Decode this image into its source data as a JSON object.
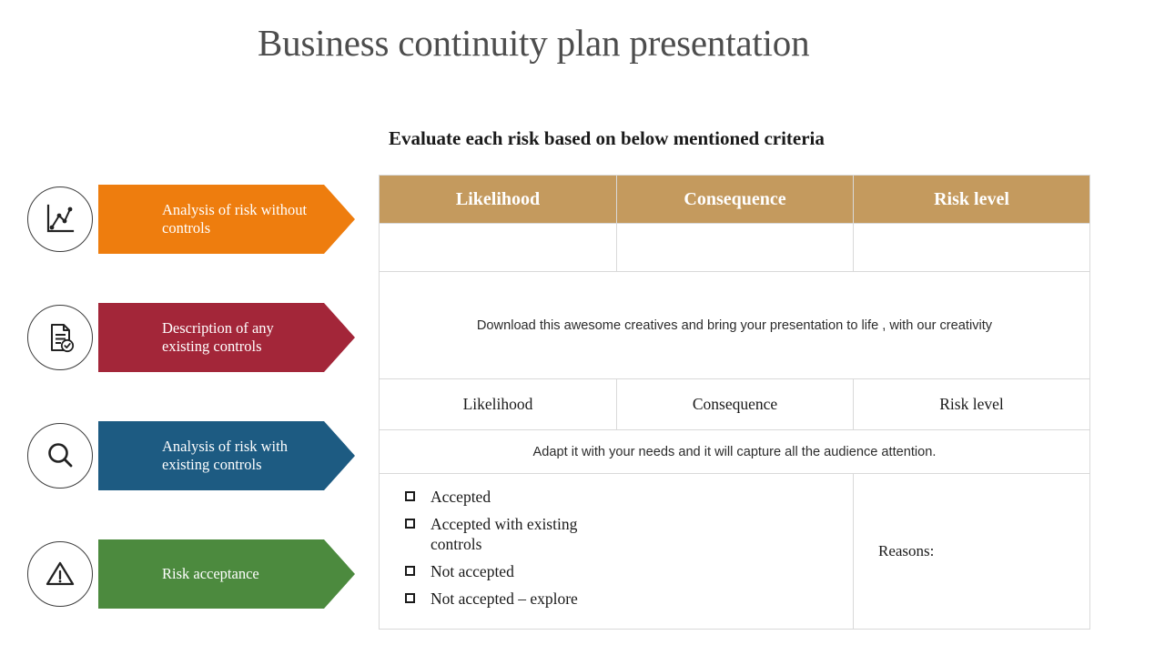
{
  "slide": {
    "title": "Business continuity plan presentation",
    "subtitle": "Evaluate each risk based on below mentioned criteria"
  },
  "steps": [
    {
      "label": "Analysis of risk without controls",
      "color": "#EE7D0E",
      "icon": "line-chart-icon"
    },
    {
      "label": "Description of any existing controls",
      "color": "#A32639",
      "icon": "document-check-icon"
    },
    {
      "label": "Analysis of risk with existing controls",
      "color": "#1D5B82",
      "icon": "magnifier-icon"
    },
    {
      "label": "Risk acceptance",
      "color": "#4C8A3E",
      "icon": "warning-triangle-icon"
    }
  ],
  "table": {
    "header_color": "#C49A5E",
    "border_color": "#D9D9D9",
    "headers": [
      "Likelihood",
      "Consequence",
      "Risk level"
    ],
    "blank_row": [
      "",
      "",
      ""
    ],
    "merged_note_1": "Download this awesome creatives and bring your presentation to life , with our creativity",
    "sub_headers": [
      "Likelihood",
      "Consequence",
      "Risk level"
    ],
    "merged_note_2": "Adapt it with your needs and it will capture all the audience attention.",
    "acceptance_options": [
      "Accepted",
      "Accepted with existing controls",
      "Not accepted",
      "Not accepted – explore"
    ],
    "reasons_label": "Reasons:"
  }
}
